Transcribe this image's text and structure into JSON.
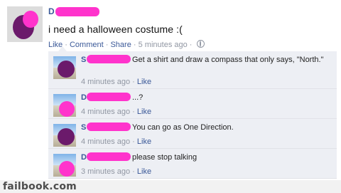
{
  "post": {
    "author": "D",
    "text": "i need a halloween costume :(",
    "actions": {
      "like": "Like",
      "comment": "Comment",
      "share": "Share",
      "timestamp": "5 minutes ago"
    }
  },
  "comments": [
    {
      "name": "S",
      "text": "Get a shirt and draw a compass that only says, \"North.\"",
      "time": "4 minutes ago",
      "like": "Like"
    },
    {
      "name": "D",
      "text": "...?",
      "time": "4 minutes ago",
      "like": "Like"
    },
    {
      "name": "S",
      "text": "You can go as One Direction.",
      "time": "4 minutes ago",
      "like": "Like"
    },
    {
      "name": "D",
      "text": "please stop talking",
      "time": "3 minutes ago",
      "like": "Like"
    }
  ],
  "footer": {
    "brand": "failbook.com"
  },
  "colors": {
    "link": "#3b5998",
    "comment_bg": "#edeff4",
    "redaction": "#ff33cc",
    "meta": "#9197a3"
  }
}
